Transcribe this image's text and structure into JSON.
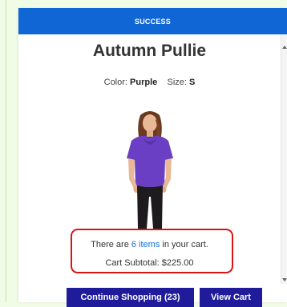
{
  "header": {
    "title": "SUCCESS"
  },
  "product": {
    "name": "Autumn Pullie",
    "color_label": "Color:",
    "color_value": "Purple",
    "size_label": "Size:",
    "size_value": "S",
    "image_alt_icon": "product-photo-woman-purple-top"
  },
  "cart": {
    "pre_text": "There are ",
    "items_link": "6 items",
    "post_text": " in your cart.",
    "subtotal_text": "Cart Subtotal: $225.00"
  },
  "buttons": {
    "continue_label": "Continue Shopping (23)",
    "view_cart_label": "View Cart"
  },
  "colors": {
    "header_bg": "#1166d6",
    "button_bg": "#1f1b9a",
    "highlight_border": "#d81414",
    "link": "#1a6fd4",
    "page_bg": "#f1fce6"
  }
}
